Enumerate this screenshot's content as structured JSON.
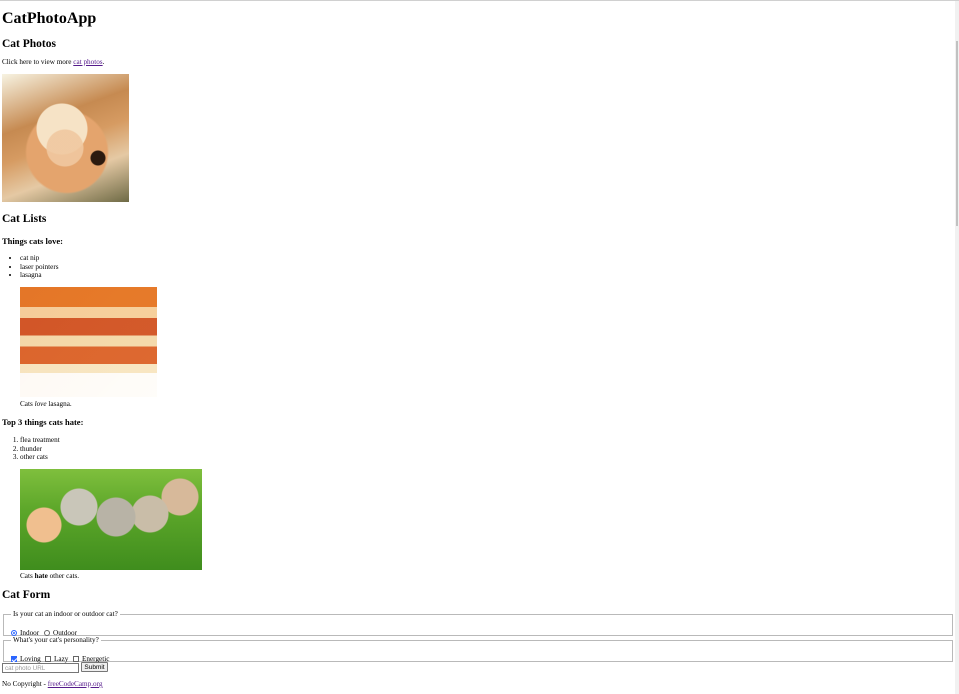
{
  "app": {
    "title": "CatPhotoApp"
  },
  "cat_photos": {
    "heading": "Cat Photos",
    "intro_prefix": "Click here to view more ",
    "link_text": "cat photos",
    "intro_suffix": ".",
    "image_alt": "A cute orange cat lying on its back."
  },
  "cat_lists": {
    "heading": "Cat Lists",
    "loves_heading": "Things cats love:",
    "loves": [
      "cat nip",
      "laser pointers",
      "lasagna"
    ],
    "lasagna_alt": "A slice of lasagna on a plate.",
    "lasagna_caption_prefix": "Cats ",
    "lasagna_caption_emphasis": "love",
    "lasagna_caption_suffix": " lasagna.",
    "hates_heading": "Top 3 things cats hate:",
    "hates": [
      "flea treatment",
      "thunder",
      "other cats"
    ],
    "kittens_alt": "Five cats looking around a field.",
    "kittens_caption_prefix": "Cats ",
    "kittens_caption_emphasis": "hate",
    "kittens_caption_suffix": " other cats."
  },
  "cat_form": {
    "heading": "Cat Form",
    "location_legend": "Is your cat an indoor or outdoor cat?",
    "location_options": [
      {
        "label": "Indoor",
        "checked": true
      },
      {
        "label": "Outdoor",
        "checked": false
      }
    ],
    "personality_legend": "What's your cat's personality?",
    "personality_options": [
      {
        "label": "Loving",
        "checked": true
      },
      {
        "label": "Lazy",
        "checked": false
      },
      {
        "label": "Energetic",
        "checked": false
      }
    ],
    "url_placeholder": "cat photo URL",
    "submit_label": "Submit"
  },
  "footer": {
    "prefix": "No Copyright - ",
    "link_text": "freeCodeCamp.org"
  }
}
